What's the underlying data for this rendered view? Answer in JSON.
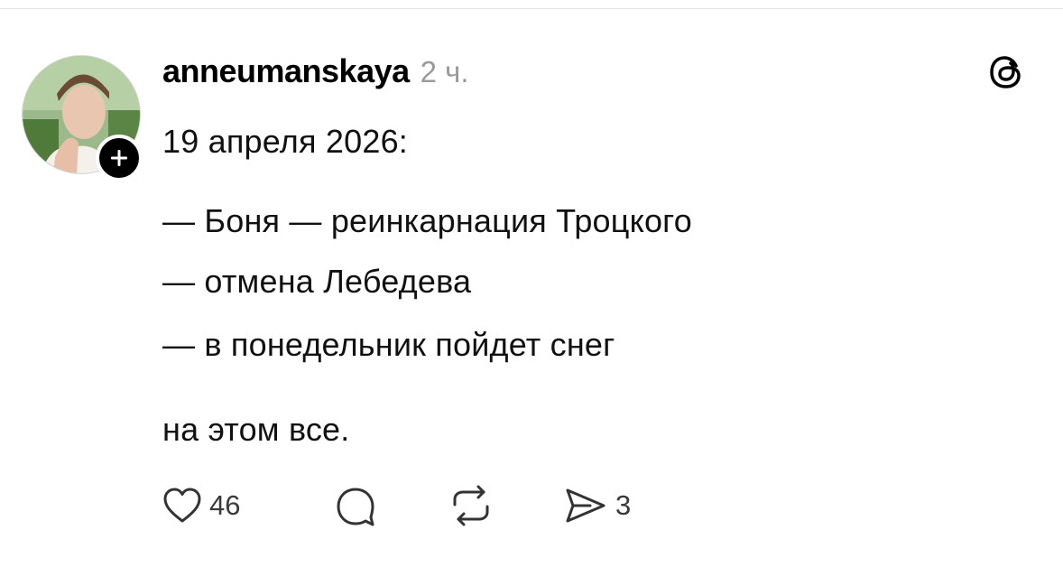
{
  "post": {
    "author": "anneumanskaya",
    "time_ago": "2 ч.",
    "date_line": "19 апреля 2026:",
    "bullets": [
      "— Боня — реинкарнация Троцкого",
      "— отмена Лебедева",
      "— в понедельник пойдет снег"
    ],
    "closing": "на этом все."
  },
  "actions": {
    "likes": "46",
    "shares": "3"
  },
  "icons": {
    "brand": "threads-icon",
    "like": "heart-icon",
    "comment": "comment-bubble-icon",
    "repost": "repost-icon",
    "share": "send-icon",
    "follow": "plus-icon"
  },
  "colors": {
    "text": "#111111",
    "muted": "#9a9a9a",
    "badge": "#000000"
  }
}
